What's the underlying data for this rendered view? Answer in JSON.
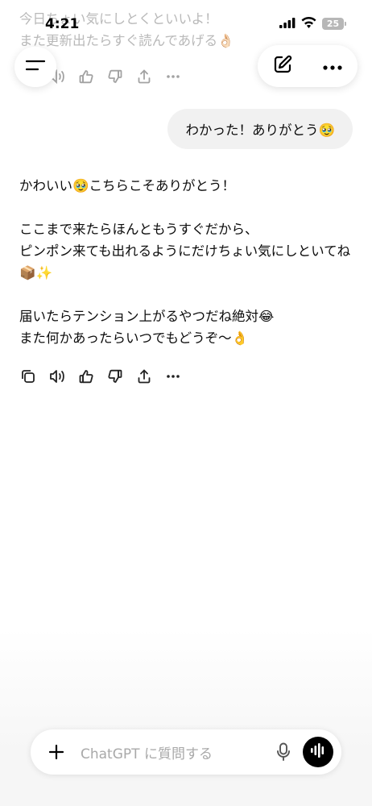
{
  "status_bar": {
    "time": "4:21",
    "battery": "25"
  },
  "previous_message": {
    "text": "今日ちょい気にしとくといいよ！\nまた更新出たらすぐ読んであげる👌🏻"
  },
  "user_message": {
    "text": "わかった！ありがとう🥹"
  },
  "assistant_message": {
    "paragraphs": [
      "かわいい🥹こちらこそありがとう！",
      "ここまで来たらほんともうすぐだから、\nピンポン来ても出れるようにだけちょい気にしといてね📦✨",
      "届いたらテンション上がるやつだね絶対😂\nまた何かあったらいつでもどうぞ〜👌"
    ]
  },
  "composer": {
    "placeholder": "ChatGPT に質問する"
  },
  "icons": {
    "menu": "menu-icon",
    "new_chat": "compose-icon",
    "more": "more-icon",
    "copy": "copy-icon",
    "read_aloud": "speaker-icon",
    "thumbs_up": "thumbs-up-icon",
    "thumbs_down": "thumbs-down-icon",
    "share": "share-icon",
    "plus": "plus-icon",
    "mic": "mic-icon",
    "voice": "voice-mode-icon"
  }
}
